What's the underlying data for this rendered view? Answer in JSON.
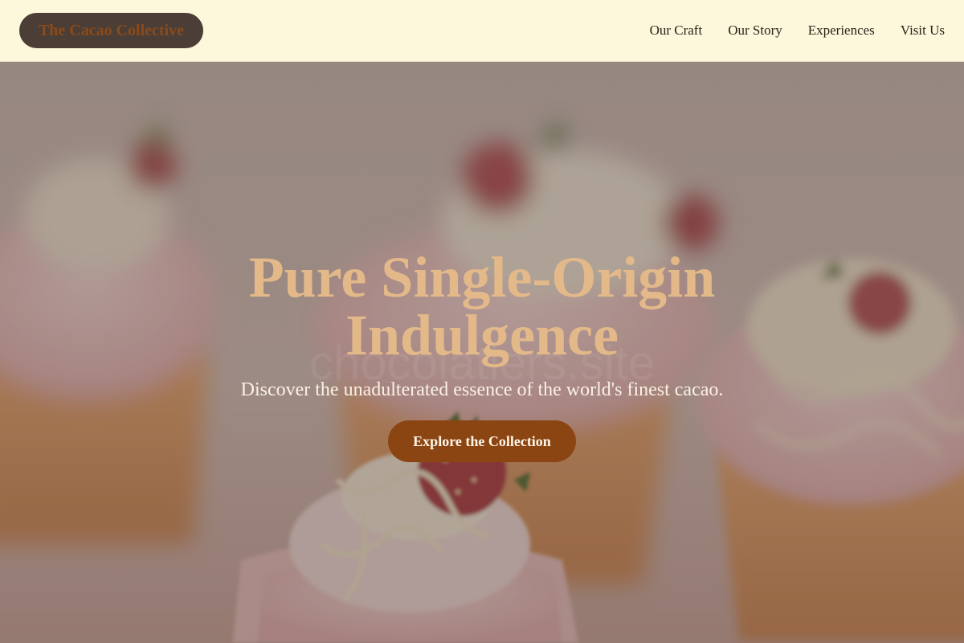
{
  "header": {
    "logo": "The Cacao Collective",
    "nav": [
      "Our Craft",
      "Our Story",
      "Experiences",
      "Visit Us"
    ]
  },
  "hero": {
    "title": "Pure Single-Origin Indulgence",
    "subtitle": "Discover the unadulterated essence of the world's finest cacao.",
    "cta": "Explore the Collection",
    "watermark": "chocolatiers.site",
    "image": "cupcakes-with-strawberries-photo"
  },
  "colors": {
    "header_bg": "#fdf7dc",
    "logo_pill": "#4b3e36",
    "logo_text": "#8a4a1a",
    "title": "#e3b98a",
    "cta_bg": "#8b4513"
  }
}
